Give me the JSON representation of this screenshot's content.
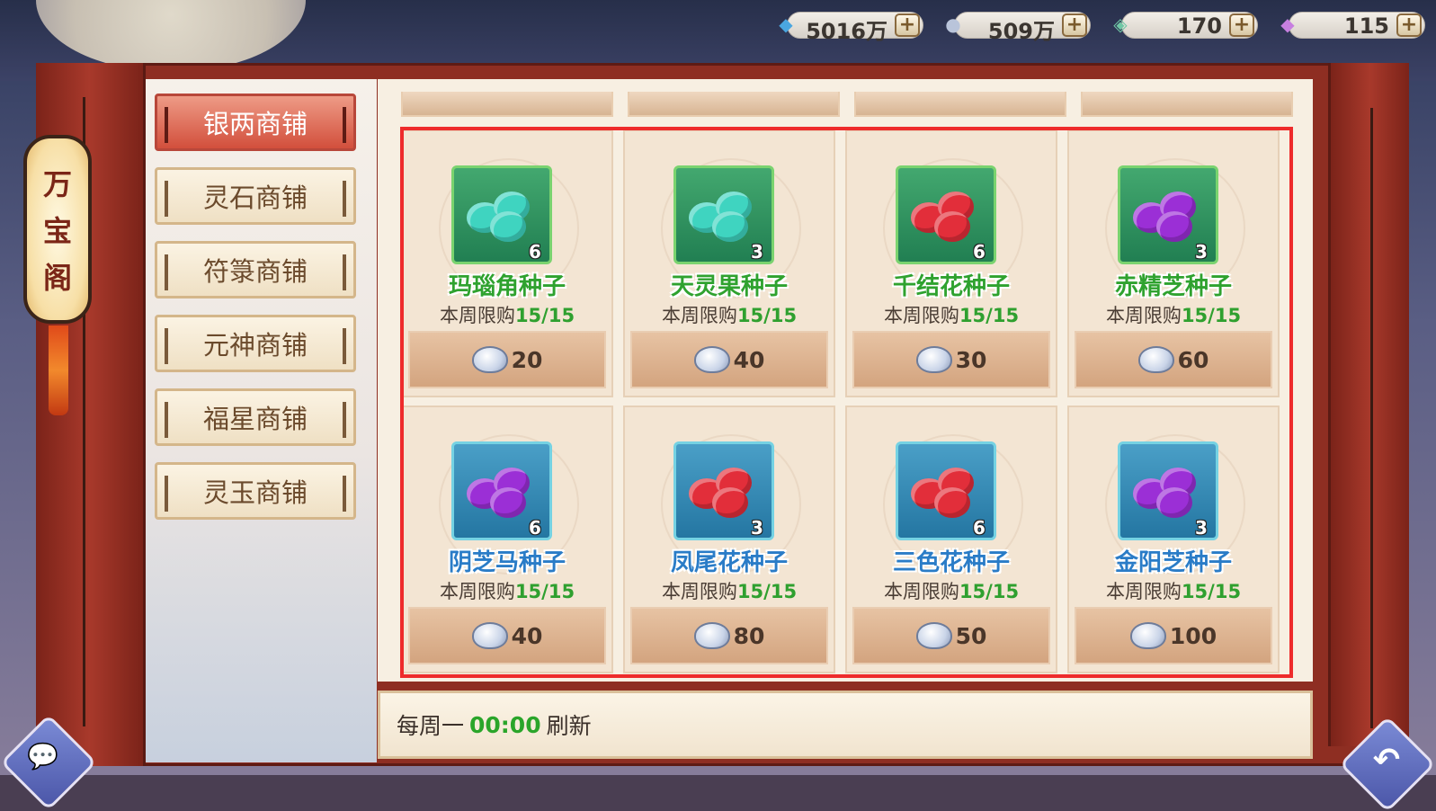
{
  "title_chars": [
    "万",
    "宝",
    "阁"
  ],
  "resources": [
    {
      "icon": "spirit-crystal-icon",
      "value": "5016万"
    },
    {
      "icon": "silver-ingot-icon",
      "value": "509万"
    },
    {
      "icon": "locked-jade-icon",
      "value": "170"
    },
    {
      "icon": "rainbow-jade-icon",
      "value": "115"
    }
  ],
  "plus_label": "+",
  "tabs": [
    {
      "label": "银两商铺",
      "active": true
    },
    {
      "label": "灵石商铺",
      "active": false
    },
    {
      "label": "符箓商铺",
      "active": false
    },
    {
      "label": "元神商铺",
      "active": false
    },
    {
      "label": "福星商铺",
      "active": false
    },
    {
      "label": "灵玉商铺",
      "active": false
    }
  ],
  "items": [
    {
      "name": "玛瑙角种子",
      "count": "6",
      "limit_label": "本周限购",
      "limit": "15/15",
      "price": "20",
      "frame": "green",
      "bean_color": "#3fd4c0"
    },
    {
      "name": "天灵果种子",
      "count": "3",
      "limit_label": "本周限购",
      "limit": "15/15",
      "price": "40",
      "frame": "green",
      "bean_color": "#3fd4c0"
    },
    {
      "name": "千结花种子",
      "count": "6",
      "limit_label": "本周限购",
      "limit": "15/15",
      "price": "30",
      "frame": "green",
      "bean_color": "#e22e3a"
    },
    {
      "name": "赤精芝种子",
      "count": "3",
      "limit_label": "本周限购",
      "limit": "15/15",
      "price": "60",
      "frame": "green",
      "bean_color": "#9b2fd6"
    },
    {
      "name": "阴芝马种子",
      "count": "6",
      "limit_label": "本周限购",
      "limit": "15/15",
      "price": "40",
      "frame": "blue",
      "bean_color": "#9b2fd6"
    },
    {
      "name": "凤尾花种子",
      "count": "3",
      "limit_label": "本周限购",
      "limit": "15/15",
      "price": "80",
      "frame": "blue",
      "bean_color": "#e22e3a"
    },
    {
      "name": "三色花种子",
      "count": "6",
      "limit_label": "本周限购",
      "limit": "15/15",
      "price": "50",
      "frame": "blue",
      "bean_color": "#e22e3a"
    },
    {
      "name": "金阳芝种子",
      "count": "3",
      "limit_label": "本周限购",
      "limit": "15/15",
      "price": "100",
      "frame": "blue",
      "bean_color": "#9b2fd6"
    }
  ],
  "notice": {
    "prefix": "每周一",
    "time": "00:00",
    "suffix": "刷新"
  },
  "chat_icon": "chat-bubble-icon",
  "back_icon": "back-arrow-icon"
}
